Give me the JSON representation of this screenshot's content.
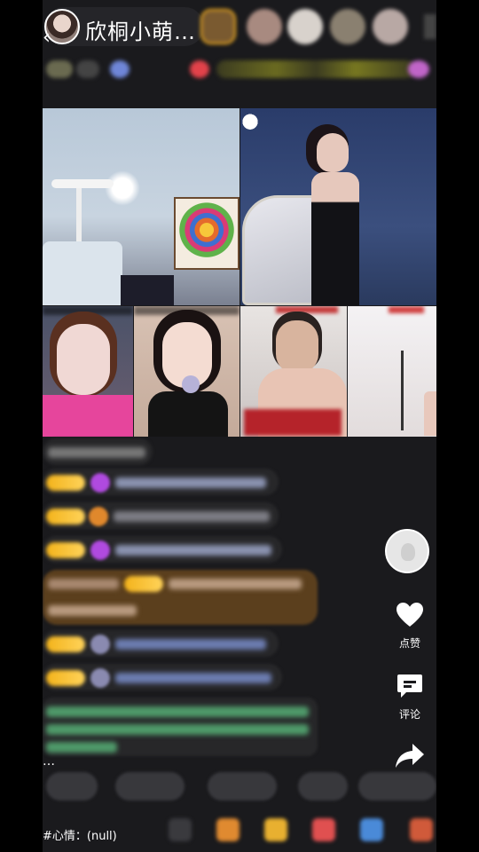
{
  "header": {
    "host_name": "欣桐小萌…",
    "back_icon": "chevron-left-icon",
    "viewers": [
      "viewer-1",
      "viewer-2",
      "viewer-3",
      "viewer-4",
      "viewer-5"
    ]
  },
  "grid": {
    "panels": [
      "panel-top-left",
      "panel-top-right",
      "panel-bottom-1",
      "panel-bottom-2",
      "panel-bottom-3",
      "panel-bottom-4"
    ]
  },
  "side_actions": {
    "like_label": "点赞",
    "comment_label": "评论",
    "share_icon": "share-arrow-icon"
  },
  "bottom": {
    "more": "…",
    "mood": "#心情：(null)"
  },
  "colors": {
    "badge": "#f3b31b",
    "background": "#1a1a1d"
  }
}
